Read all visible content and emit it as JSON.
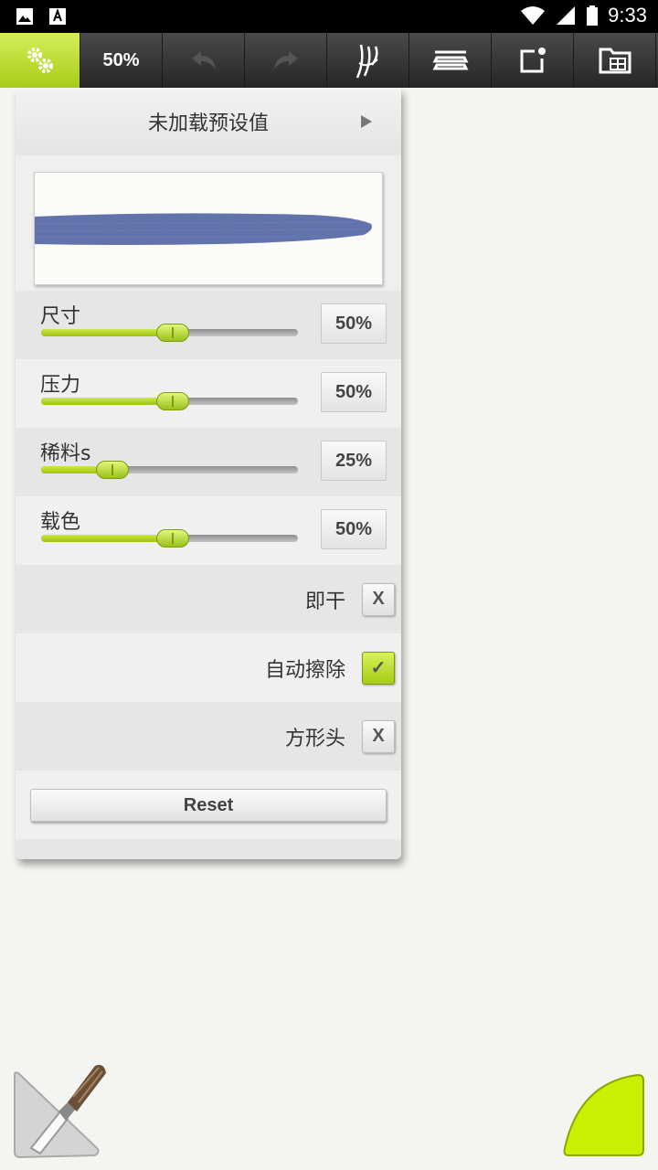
{
  "status_bar": {
    "time": "9:33",
    "icons": [
      "image-icon",
      "text-a-icon",
      "wifi-icon",
      "signal-icon",
      "battery-icon"
    ]
  },
  "toolbar": {
    "settings_icon": "gears-icon",
    "zoom": "50%",
    "undo_icon": "undo-icon",
    "redo_icon": "redo-icon",
    "brush_icon": "brush-strokes-icon",
    "layers_icon": "layers-icon",
    "share_icon": "share-icon",
    "gallery_icon": "gallery-icon",
    "accent": "#b5d62a"
  },
  "panel": {
    "preset_title": "未加载预设值",
    "stroke_color": "#5a6aa6",
    "sliders": [
      {
        "label": "尺寸",
        "value": "50%",
        "level": 0.5
      },
      {
        "label": "压力",
        "value": "50%",
        "level": 0.5
      },
      {
        "label": "稀料s",
        "value": "25%",
        "level": 0.25
      },
      {
        "label": "载色",
        "value": "50%",
        "level": 0.5
      }
    ],
    "toggles": [
      {
        "label": "即干",
        "checked": false,
        "mark": "X"
      },
      {
        "label": "自动擦除",
        "checked": true,
        "mark": "✓"
      },
      {
        "label": "方形头",
        "checked": false,
        "mark": "X"
      }
    ],
    "reset_label": "Reset"
  },
  "bottom": {
    "brush_tool_icon": "paintbrush-icon",
    "color_tool_color": "#c8f000"
  }
}
